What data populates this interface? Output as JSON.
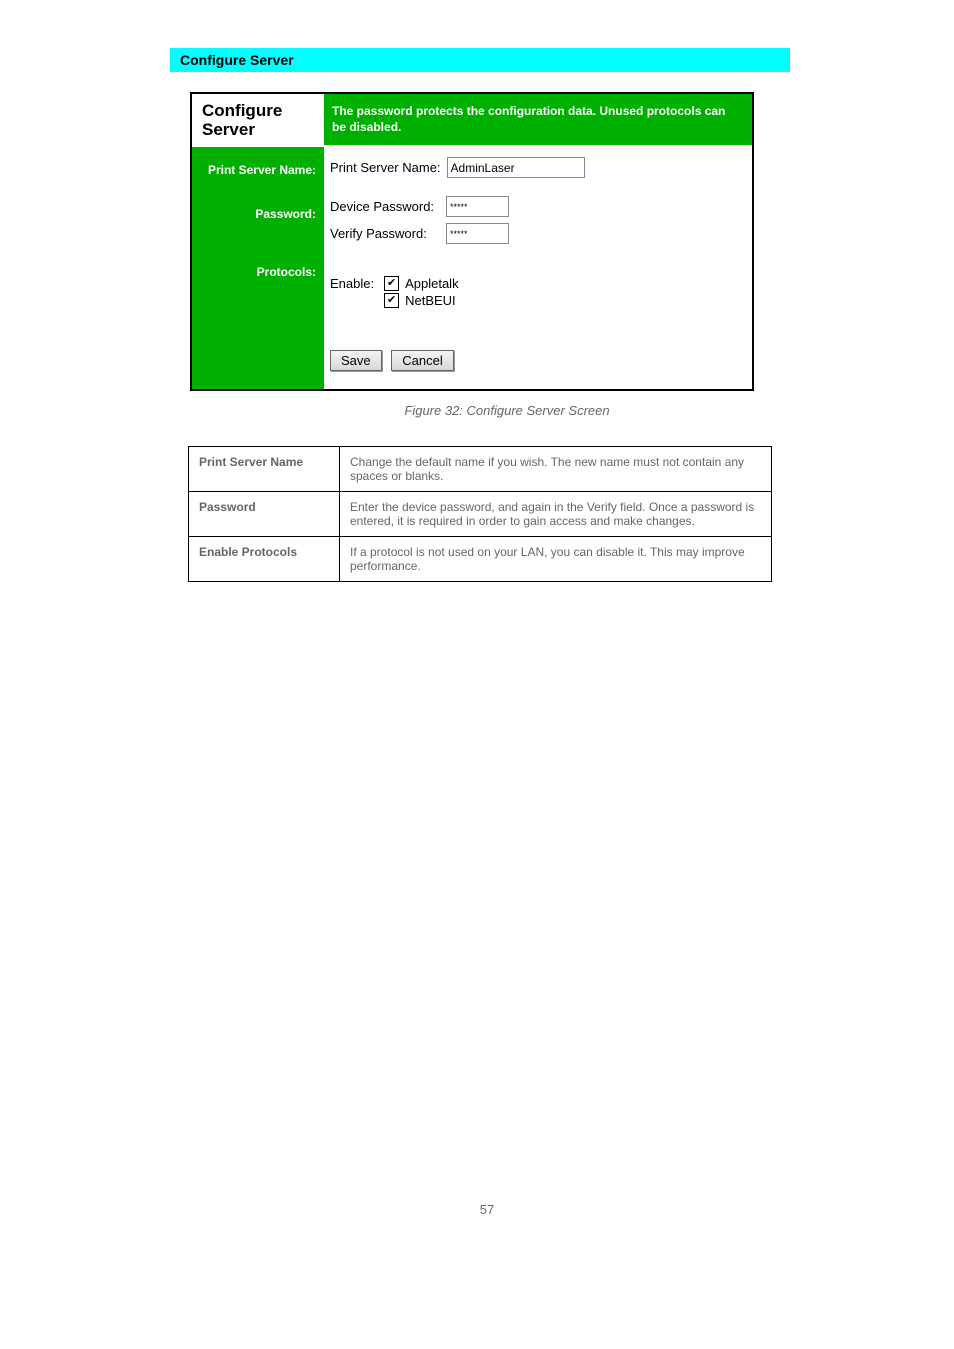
{
  "topbar": "Configure Server",
  "panel": {
    "title": "Configure Server",
    "header": "The password protects the configuration data. Unused protocols can be disabled.",
    "left_labels": {
      "name": "Print Server Name:",
      "password": "Password:",
      "protocols": "Protocols:"
    },
    "rows": {
      "psn_label": "Print Server Name:",
      "psn_value": "AdminLaser",
      "devpw_label": "Device Password:",
      "devpw_value": "*****",
      "verpw_label": "Verify Password:",
      "verpw_value": "*****",
      "enable_label": "Enable:",
      "proto1": "Appletalk",
      "proto2": "NetBEUI"
    },
    "buttons": {
      "save": "Save",
      "cancel": "Cancel"
    }
  },
  "figure_caption": "Figure 32: Configure Server Screen",
  "table": {
    "r1k": "Print Server Name",
    "r1v": "Change the default name if you wish. The new name must not contain any spaces or blanks.",
    "r2k": "Password",
    "r2v": "Enter the device password, and again in the Verify field. Once a password is entered, it is required in order to gain access and make changes.",
    "r3k": "Enable Protocols",
    "r3v": "If a protocol is not used on your LAN, you can disable it. This may improve performance."
  },
  "page_number": "57"
}
